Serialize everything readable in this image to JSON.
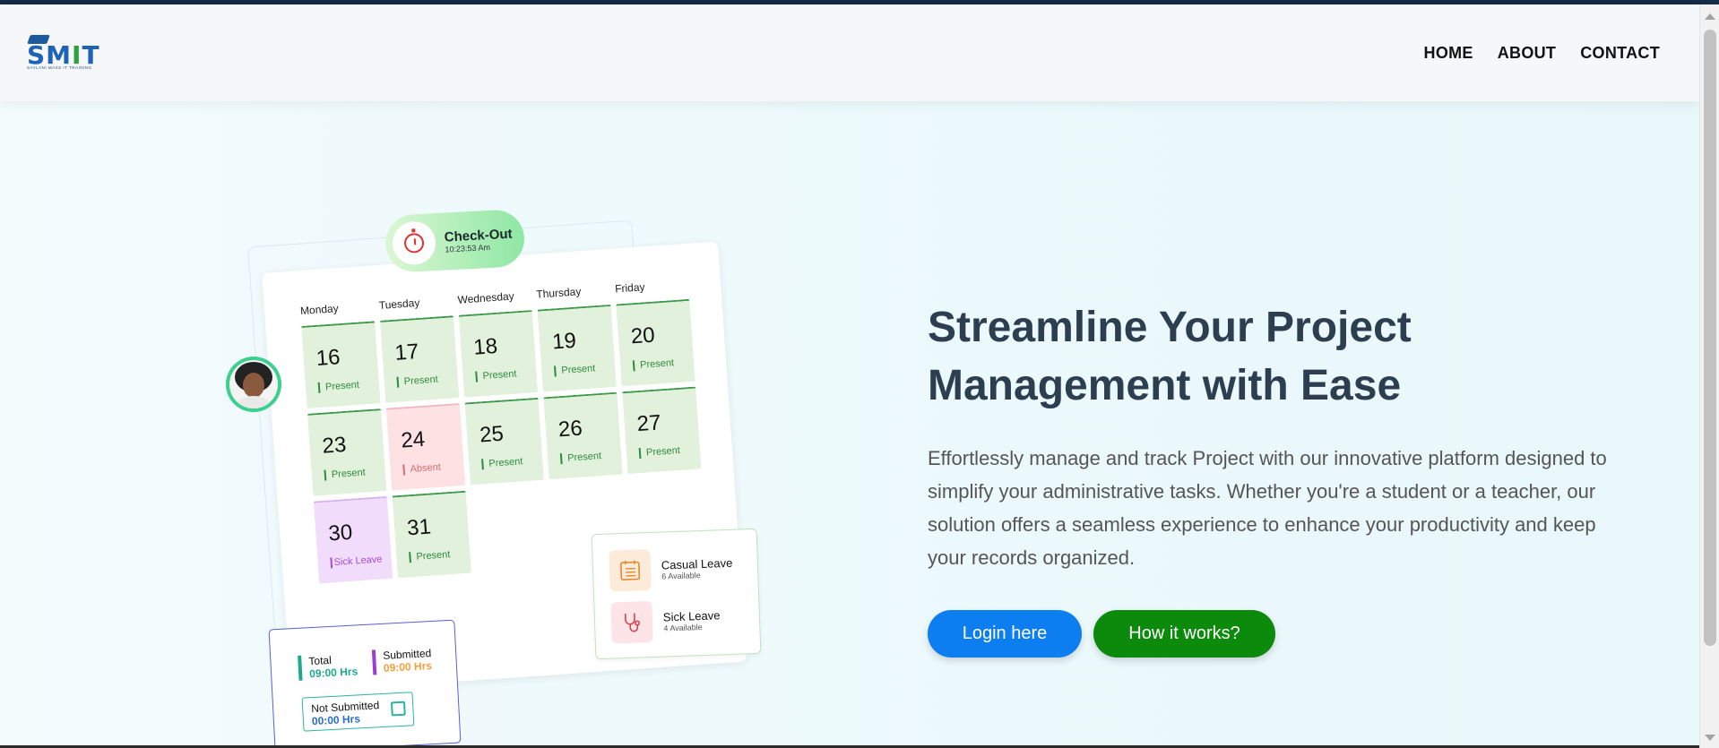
{
  "brand": {
    "logo_text_s": "S",
    "logo_text_m": "M",
    "logo_text_i": "I",
    "logo_text_t": "T",
    "logo_sub": "SAYLANI MASS IT TRAINING"
  },
  "nav": {
    "home": "HOME",
    "about": "ABOUT",
    "contact": "CONTACT"
  },
  "illustration": {
    "checkout": {
      "title": "Check-Out",
      "time": "10:23:53 Am"
    },
    "days": [
      "Monday",
      "Tuesday",
      "Wednesday",
      "Thursday",
      "Friday"
    ],
    "cells": [
      {
        "num": "16",
        "status": "Present"
      },
      {
        "num": "17",
        "status": "Present"
      },
      {
        "num": "18",
        "status": "Present"
      },
      {
        "num": "19",
        "status": "Present"
      },
      {
        "num": "20",
        "status": "Present"
      },
      {
        "num": "23",
        "status": "Present"
      },
      {
        "num": "24",
        "status": "Absent"
      },
      {
        "num": "25",
        "status": "Present"
      },
      {
        "num": "26",
        "status": "Present"
      },
      {
        "num": "27",
        "status": "Present"
      },
      {
        "num": "30",
        "status": "Sick Leave"
      },
      {
        "num": "31",
        "status": "Present"
      }
    ],
    "leave": {
      "casual_title": "Casual Leave",
      "casual_sub": "6 Available",
      "sick_title": "Sick Leave",
      "sick_sub": "4 Available"
    },
    "hours": {
      "total_label": "Total",
      "total_value": "09:00 Hrs",
      "submitted_label": "Submitted",
      "submitted_value": "09:00 Hrs",
      "not_submitted_label": "Not Submitted",
      "not_submitted_value": "00:00 Hrs"
    }
  },
  "hero": {
    "title_line1": "Streamline Your Project",
    "title_line2": "Management with Ease",
    "description": "Effortlessly manage and track Project with our innovative platform designed to simplify your administrative tasks. Whether you're a student or a teacher, our solution offers a seamless experience to enhance your productivity and keep your records organized.",
    "login_button": "Login here",
    "how_button": "How it works?"
  },
  "colors": {
    "primary_blue": "#0d7ef0",
    "primary_green": "#0b8a0b",
    "heading": "#2c3e50"
  }
}
